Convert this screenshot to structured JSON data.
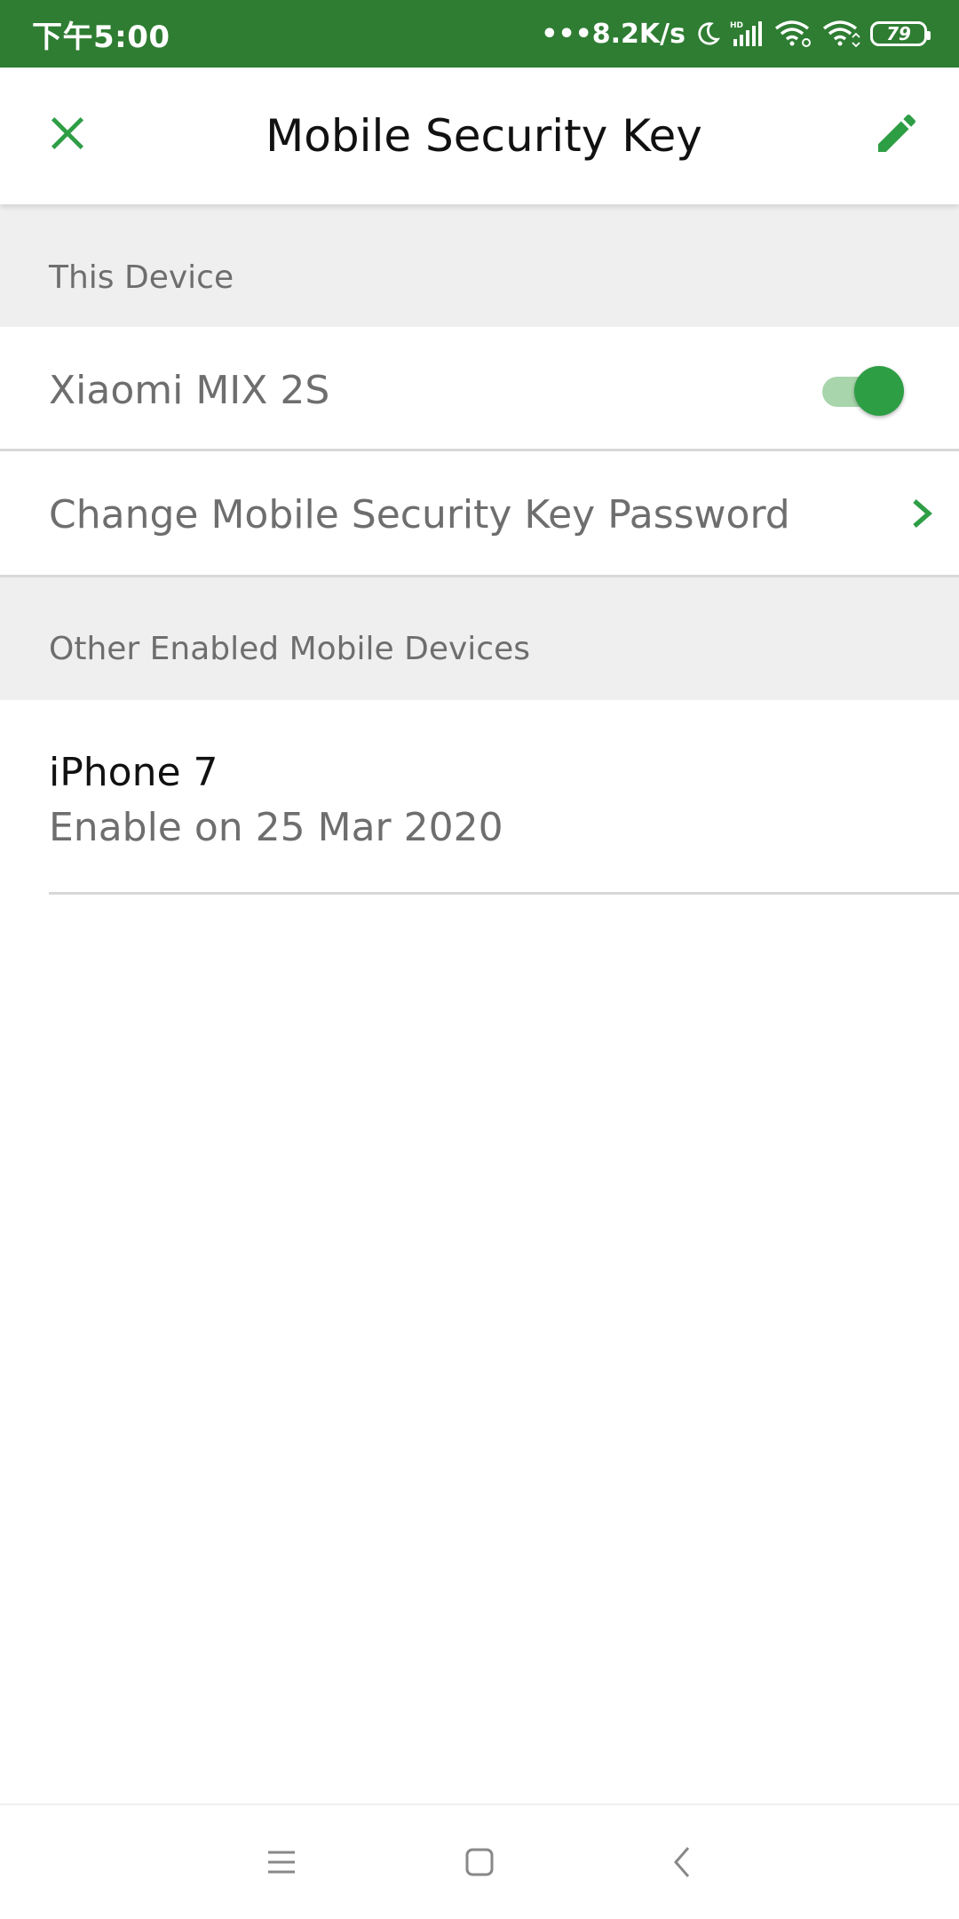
{
  "status_bar": {
    "time": "下午5:00",
    "network_speed": "•••8.2K/s",
    "icons": [
      "moon-icon",
      "hd-signal-icon",
      "wifi-calling-icon",
      "wifi-icon"
    ],
    "battery_level": "79",
    "background_color": "#2e7d32"
  },
  "app_bar": {
    "title": "Mobile Security Key",
    "close_icon": "close-icon",
    "edit_icon": "pencil-icon",
    "accent_color": "#2e9e45"
  },
  "this_device_section": {
    "header": "This Device",
    "device_name": "Xiaomi MIX 2S",
    "toggle_on": true,
    "change_password_label": "Change Mobile Security Key Password"
  },
  "other_devices_section": {
    "header": "Other Enabled Mobile Devices",
    "devices": [
      {
        "name": "iPhone 7",
        "enabled_text": "Enable on 25 Mar 2020"
      }
    ]
  },
  "nav_bar": {
    "buttons": [
      "menu-icon",
      "home-icon",
      "back-icon"
    ]
  }
}
